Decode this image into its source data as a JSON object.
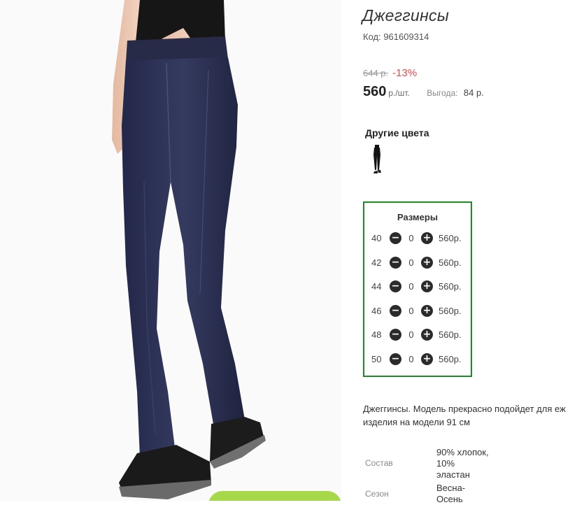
{
  "product": {
    "title": "Джеггинсы",
    "code": "Код: 961609314",
    "old_price": "644 р.",
    "discount": "-13%",
    "price": "560",
    "unit": "р./шт.",
    "benefit_label": "Выгода:",
    "benefit_value": "84 р."
  },
  "other_colors": {
    "title": "Другие цвета"
  },
  "sizes": {
    "title": "Размеры",
    "minus_symbol": "−",
    "plus_symbol": "+",
    "rows": [
      {
        "size": "40",
        "qty": "0",
        "price": "560р."
      },
      {
        "size": "42",
        "qty": "0",
        "price": "560р."
      },
      {
        "size": "44",
        "qty": "0",
        "price": "560р."
      },
      {
        "size": "46",
        "qty": "0",
        "price": "560р."
      },
      {
        "size": "48",
        "qty": "0",
        "price": "560р."
      },
      {
        "size": "50",
        "qty": "0",
        "price": "560р."
      }
    ]
  },
  "description": {
    "line1": "Джегги­нсы. Модель прекрасно подойдет для еж",
    "line2": "изделия на модели 91 см"
  },
  "properties": {
    "composition_label": "Состав",
    "composition_value_1": "90% хлопок,",
    "composition_value_2": "10%",
    "composition_value_3": "эластан",
    "season_label": "Сезон",
    "season_value_1": "Весна-",
    "season_value_2": "Осень"
  },
  "colors": {
    "accent_green": "#1e8b24",
    "discount_red": "#e8484a",
    "button_green": "#a6d84a",
    "denim": "#2c3050"
  }
}
